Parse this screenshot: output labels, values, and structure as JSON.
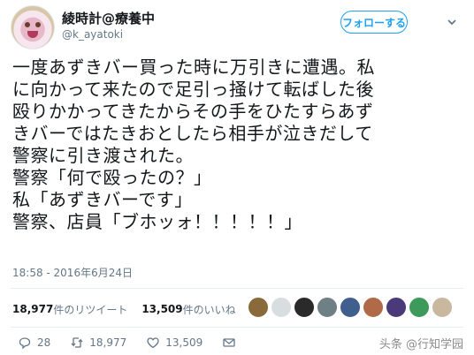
{
  "user": {
    "display_name": "綾時計@療養中",
    "handle": "@k_ayatoki"
  },
  "follow_button": {
    "label": "フォローする"
  },
  "tweet": {
    "lines": [
      "一度あずきバー買った時に万引きに遭遇。私",
      "に向かって来たので足引っ掻けて転ばした後",
      "殴りかかってきたからその手をひたすらあず",
      "きバーではたきおとしたら相手が泣きだして",
      "警察に引き渡された。",
      "警察「何で殴ったの？」",
      "私「あずきバーです」",
      "警察、店員「ブホッォ！！！！！」"
    ],
    "timestamp": "18:58 - 2016年6月24日"
  },
  "stats": {
    "retweets_count": "18,977",
    "retweets_label": "件のリツイート",
    "likes_count": "13,509",
    "likes_label": "件のいいね"
  },
  "likers": [
    {
      "icon": "liker-avatar-1",
      "color": "#8a6a3a"
    },
    {
      "icon": "liker-avatar-2",
      "color": "#d8dde0"
    },
    {
      "icon": "liker-avatar-3",
      "color": "#2a2a2a"
    },
    {
      "icon": "liker-avatar-4",
      "color": "#6f7f86"
    },
    {
      "icon": "liker-avatar-5",
      "color": "#3f5f8f"
    },
    {
      "icon": "liker-avatar-6",
      "color": "#b06a48"
    },
    {
      "icon": "liker-avatar-7",
      "color": "#4a3a7a"
    },
    {
      "icon": "liker-avatar-8",
      "color": "#3e9a5a"
    },
    {
      "icon": "liker-avatar-9",
      "color": "#c9b7a0"
    }
  ],
  "actions": {
    "reply_count": "28",
    "retweet_count": "18,977",
    "like_count": "13,509"
  },
  "watermark": "头条 @行知学园",
  "colors": {
    "accent": "#1da1f2",
    "muted": "#657786",
    "text": "#14171a"
  }
}
